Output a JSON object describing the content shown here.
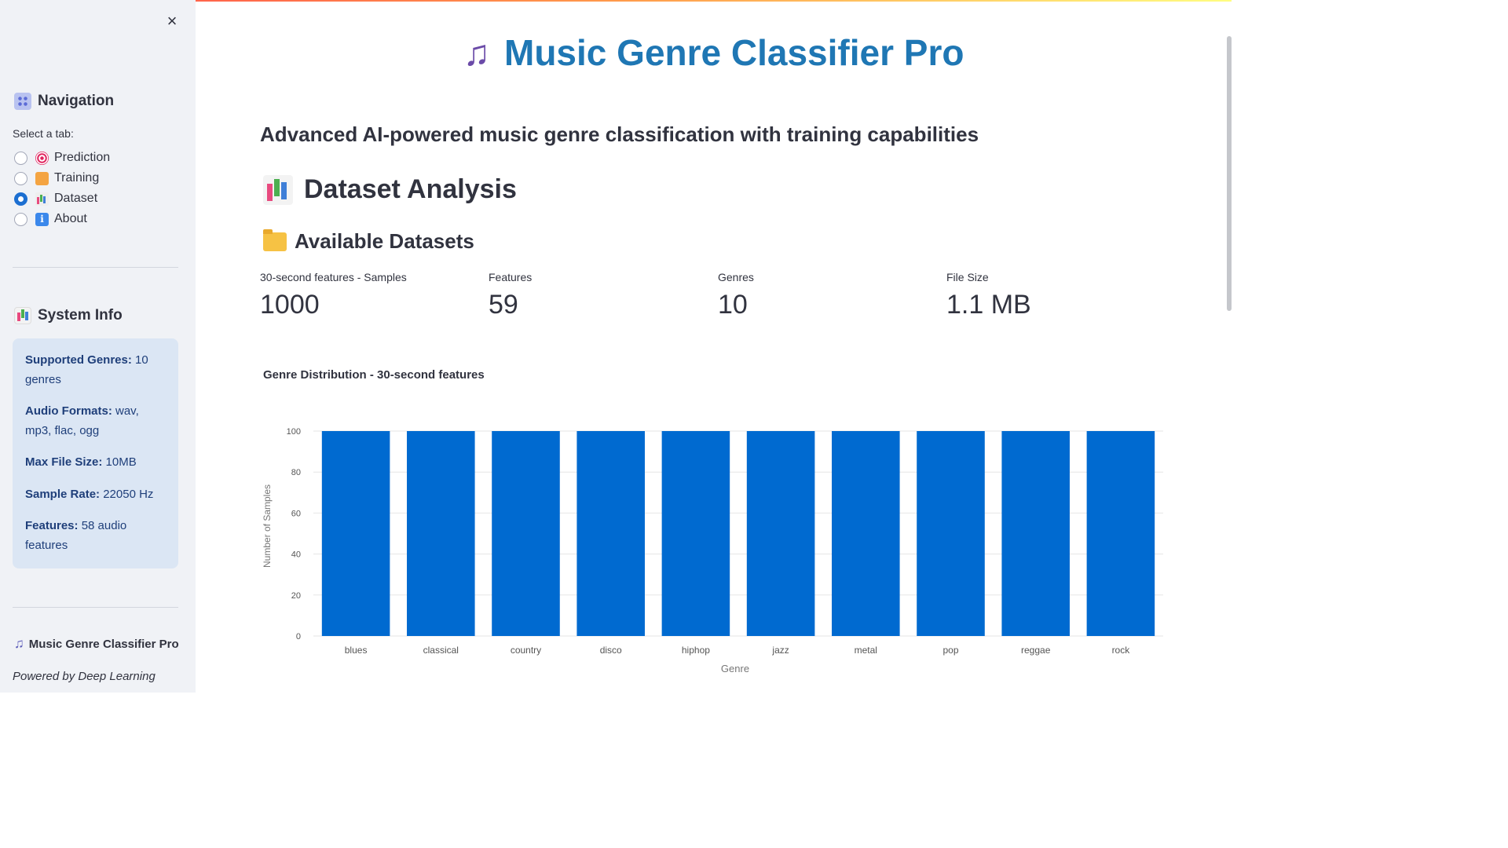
{
  "sidebar": {
    "close_label": "×",
    "nav_heading": "Navigation",
    "select_label": "Select a tab:",
    "tabs": [
      {
        "label": "Prediction",
        "icon": "target-icon",
        "selected": false
      },
      {
        "label": "Training",
        "icon": "weightlifter-icon",
        "selected": false
      },
      {
        "label": "Dataset",
        "icon": "bar-chart-icon",
        "selected": true
      },
      {
        "label": "About",
        "icon": "info-icon",
        "selected": false
      }
    ],
    "system_heading": "System Info",
    "info": [
      {
        "key": "Supported Genres:",
        "value": " 10 genres"
      },
      {
        "key": "Audio Formats:",
        "value": " wav, mp3, flac, ogg"
      },
      {
        "key": "Max File Size:",
        "value": " 10MB"
      },
      {
        "key": "Sample Rate:",
        "value": " 22050 Hz"
      },
      {
        "key": "Features:",
        "value": " 58 audio features"
      }
    ],
    "footer_title": "Music Genre Classifier Pro",
    "footer_sub": "Powered by Deep Learning"
  },
  "main": {
    "title": "Music Genre Classifier Pro",
    "subtitle": "Advanced AI-powered music genre classification with training capabilities",
    "section_heading": "Dataset Analysis",
    "subsection_heading": "Available Datasets",
    "metrics": [
      {
        "label": "30-second features - Samples",
        "value": "1000"
      },
      {
        "label": "Features",
        "value": "59"
      },
      {
        "label": "Genres",
        "value": "10"
      },
      {
        "label": "File Size",
        "value": "1.1 MB"
      }
    ]
  },
  "colors": {
    "accent": "#1f77b4",
    "bar": "#006ad0",
    "info_bg": "#dbe6f4",
    "radio_on": "#1c6fd1"
  },
  "chart_data": {
    "type": "bar",
    "title": "Genre Distribution - 30-second features",
    "xlabel": "Genre",
    "ylabel": "Number of Samples",
    "categories": [
      "blues",
      "classical",
      "country",
      "disco",
      "hiphop",
      "jazz",
      "metal",
      "pop",
      "reggae",
      "rock"
    ],
    "values": [
      100,
      100,
      100,
      100,
      100,
      100,
      100,
      100,
      100,
      100
    ],
    "ylim": [
      0,
      100
    ],
    "yticks": [
      0,
      20,
      40,
      60,
      80,
      100
    ],
    "grid": true
  }
}
